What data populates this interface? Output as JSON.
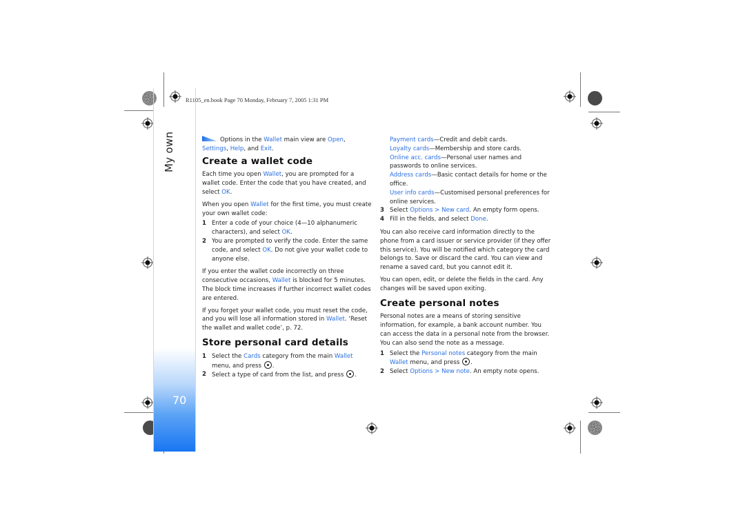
{
  "header": {
    "running_head": "R1105_en.book  Page 70  Monday, February 7, 2005  1:31 PM"
  },
  "sidebar": {
    "section_title": "My own",
    "page_number": "70"
  },
  "colors": {
    "link": "#2a6fe0",
    "sidebar_gradient_end": "#1976f2",
    "sidebar_border": "#bcdcf5"
  },
  "left_column": {
    "tip": {
      "icon": "tip-icon",
      "parts": [
        "Options in the ",
        "Wallet",
        " main view are ",
        "Open",
        ", ",
        "Settings",
        ", ",
        "Help",
        ", and ",
        "Exit",
        "."
      ]
    },
    "section1": {
      "heading": "Create a wallet code",
      "p1": [
        "Each time you open ",
        "Wallet",
        ", you are prompted for a wallet code. Enter the code that you have created, and select ",
        "OK",
        "."
      ],
      "p2": [
        "When you open ",
        "Wallet",
        " for the first time, you must create your own wallet code:"
      ],
      "steps": [
        {
          "n": "1",
          "parts": [
            "Enter a code of your choice (4—10 alphanumeric characters), and select ",
            "OK",
            "."
          ]
        },
        {
          "n": "2",
          "parts": [
            "You are prompted to verify the code. Enter the same code, and select ",
            "OK",
            ". Do not give your wallet code to anyone else."
          ]
        }
      ],
      "p3": [
        "If you enter the wallet code incorrectly on three consecutive occasions, ",
        "Wallet",
        " is blocked for 5 minutes. The block time increases if further incorrect wallet codes are entered."
      ],
      "p4": [
        "If you forget your wallet code, you must reset the code, and you will lose all information stored in ",
        "Wallet",
        ". ‘Reset the wallet and wallet code’, p. 72."
      ]
    },
    "section2": {
      "heading": "Store personal card details",
      "steps": [
        {
          "n": "1",
          "parts": [
            "Select the ",
            "Cards",
            " category from the main ",
            "Wallet",
            " menu, and press "
          ],
          "end": "."
        },
        {
          "n": "2",
          "parts": [
            "Select a type of card from the list, and press "
          ],
          "end": "."
        }
      ]
    }
  },
  "right_column": {
    "card_types": [
      {
        "name": "Payment cards",
        "desc": "—Credit and debit cards."
      },
      {
        "name": "Loyalty cards",
        "desc": "—Membership and store cards."
      },
      {
        "name": "Online acc. cards",
        "desc": "—Personal user names and passwords to online services."
      },
      {
        "name": "Address cards",
        "desc": "—Basic contact details for home or the office."
      },
      {
        "name": "User info cards",
        "desc": "—Customised personal preferences for online services."
      }
    ],
    "steps": [
      {
        "n": "3",
        "parts": [
          "Select ",
          "Options > New card",
          ". An empty form opens."
        ]
      },
      {
        "n": "4",
        "parts": [
          "Fill in the fields, and select ",
          "Done",
          "."
        ]
      }
    ],
    "p1": "You can also receive card information directly to the phone from a card issuer or service provider (if they offer this service). You will be notified which category the card belongs to. Save or discard the card. You can view and rename a saved card, but you cannot edit it.",
    "p2": "You can open, edit, or delete the fields in the card. Any changes will be saved upon exiting.",
    "section3": {
      "heading": "Create personal notes",
      "p1": "Personal notes are a means of storing sensitive information, for example, a bank account number. You can access the data in a personal note from the browser. You can also send the note as a message.",
      "steps": [
        {
          "n": "1",
          "parts": [
            "Select the ",
            "Personal notes",
            " category from the main ",
            "Wallet",
            " menu, and press "
          ],
          "end": "."
        },
        {
          "n": "2",
          "parts": [
            "Select ",
            "Options > New note",
            ". An empty note opens."
          ]
        }
      ]
    }
  }
}
